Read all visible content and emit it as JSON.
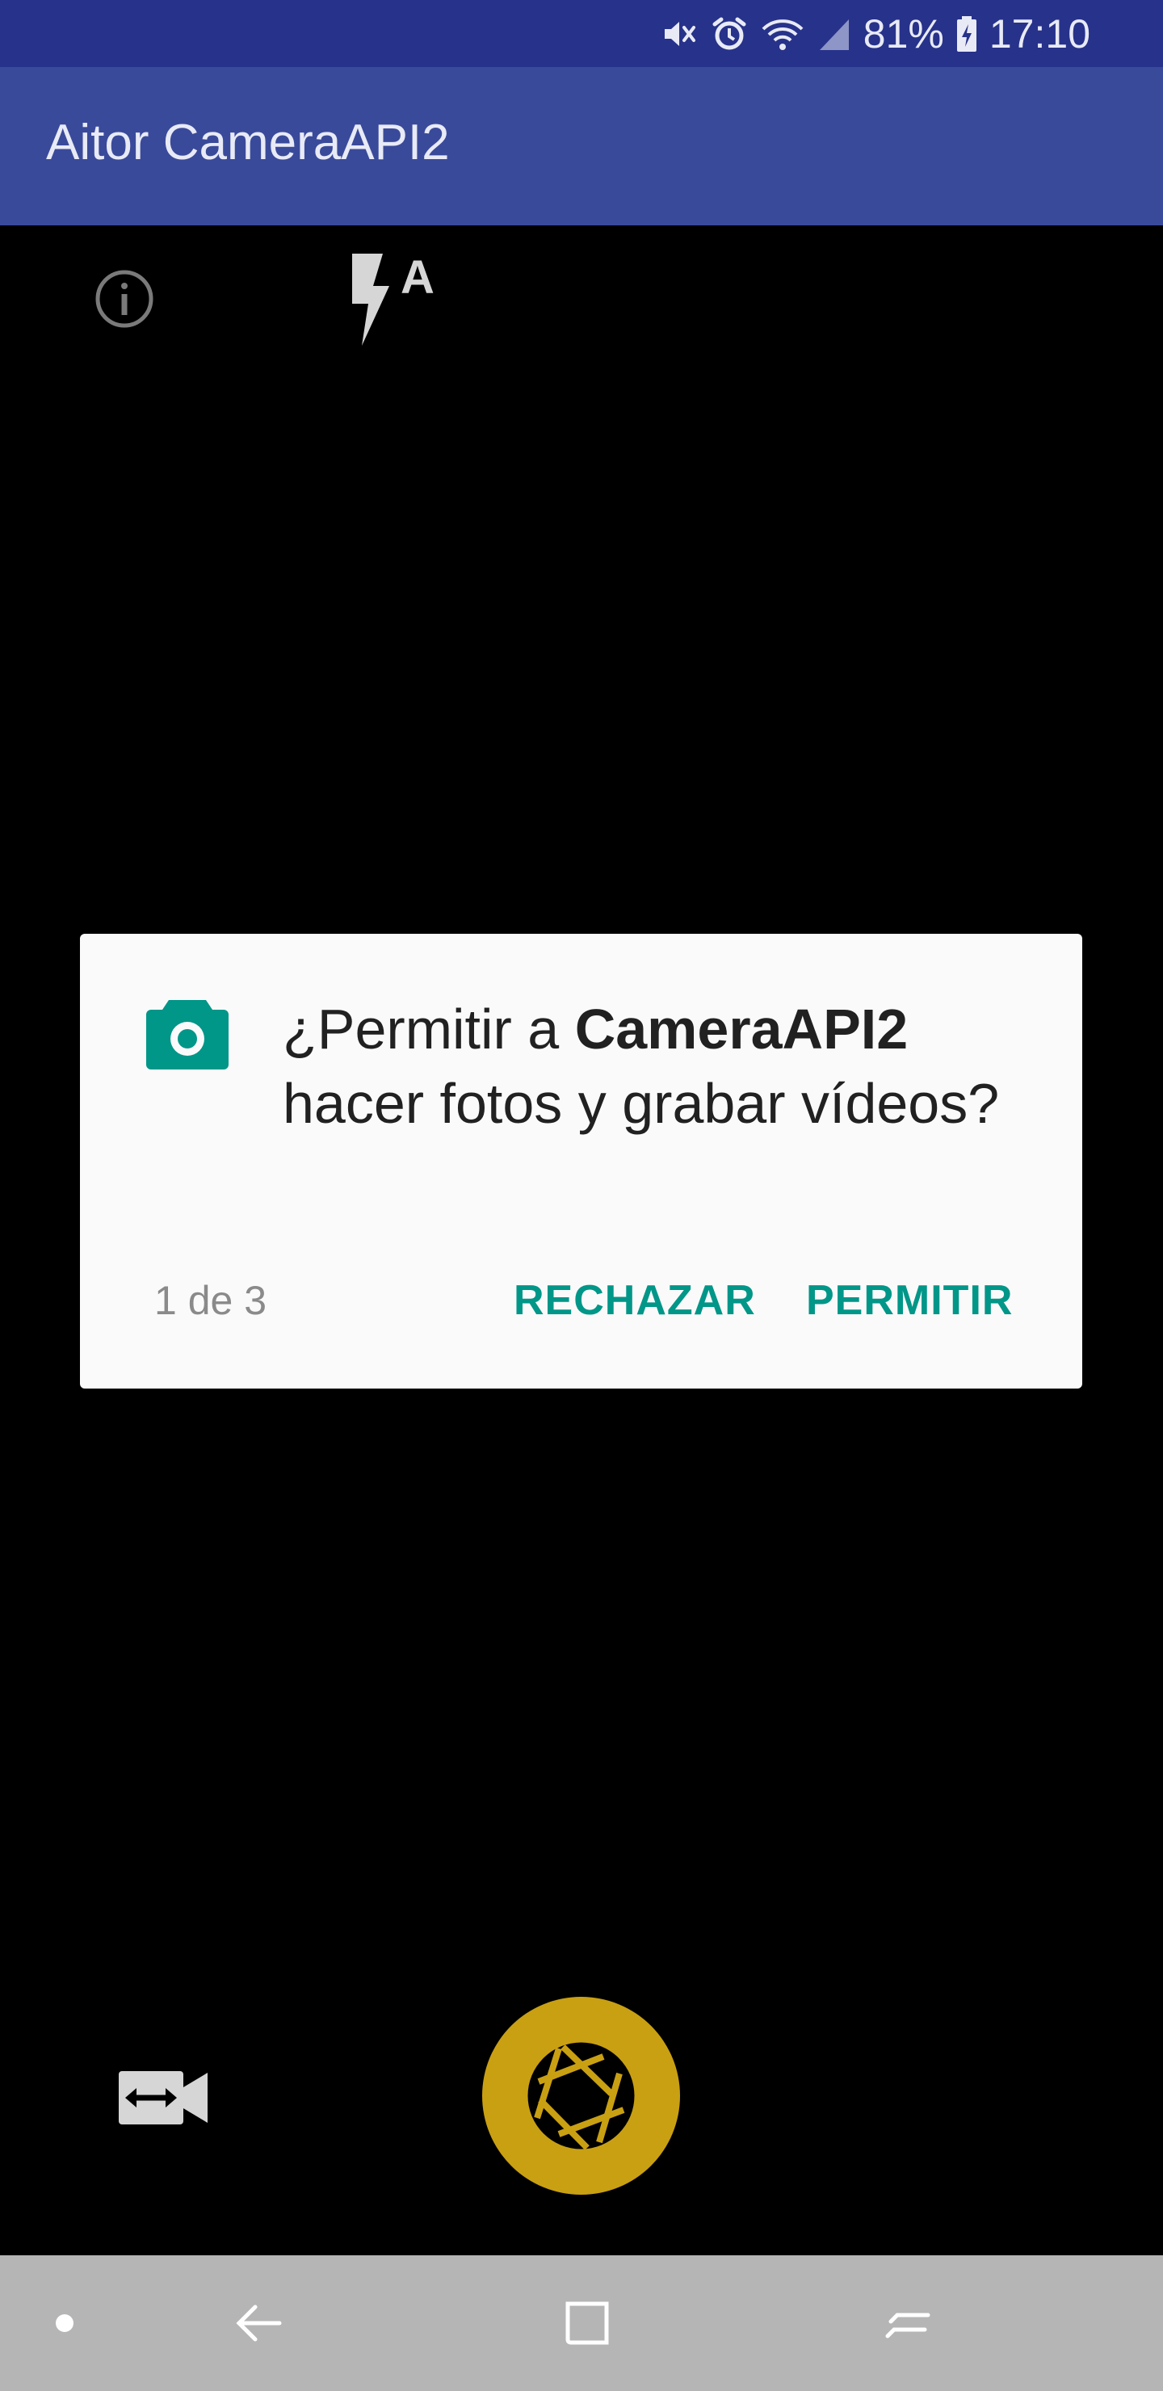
{
  "status_bar": {
    "battery_percent": "81%",
    "time": "17:10",
    "icons": [
      "mute-icon",
      "alarm-icon",
      "wifi-icon",
      "signal-icon",
      "battery-charging-icon"
    ]
  },
  "app_bar": {
    "title": "Aitor CameraAPI2"
  },
  "camera_controls": {
    "top": [
      "info-icon",
      "flash-auto-icon"
    ],
    "bottom": [
      "switch-camera-icon",
      "shutter-icon"
    ],
    "flash_mode_label": "A"
  },
  "permission_dialog": {
    "icon": "camera-icon",
    "message_prefix": "¿Permitir a ",
    "app_name": "CameraAPI2",
    "message_suffix": " hacer fotos y grabar vídeos?",
    "counter": "1 de 3",
    "deny_label": "RECHAZAR",
    "allow_label": "PERMITIR",
    "accent_color": "#009688"
  },
  "nav_bar": {
    "items": [
      "dot-icon",
      "back-icon",
      "home-icon",
      "recents-icon"
    ]
  },
  "colors": {
    "status_bar": "#27328a",
    "app_bar": "#3a4a9a",
    "shutter": "#c9a012",
    "nav_bar": "#b5b5b5"
  }
}
